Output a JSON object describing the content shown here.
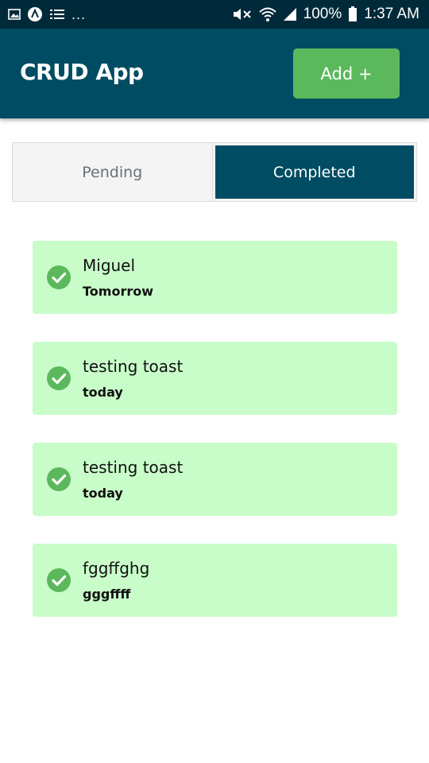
{
  "status_bar": {
    "dots": "...",
    "battery_percent": "100%",
    "time": "1:37 AM"
  },
  "header": {
    "title": "CRUD App",
    "add_label": "Add +"
  },
  "tabs": [
    {
      "label": "Pending",
      "active": false
    },
    {
      "label": "Completed",
      "active": true
    }
  ],
  "tasks": [
    {
      "title": "Miguel",
      "subtitle": "Tomorrow"
    },
    {
      "title": "testing toast",
      "subtitle": "today"
    },
    {
      "title": "testing toast",
      "subtitle": "today"
    },
    {
      "title": "fggffghg",
      "subtitle": "gggffff"
    }
  ],
  "icons": {
    "check": "check-circle-icon"
  },
  "colors": {
    "status_bar": "#002a3a",
    "app_bar": "#004c63",
    "add_button": "#5cb85c",
    "tab_active": "#004c63",
    "card_bg": "#c8fcc8",
    "check_green": "#5cb85c"
  }
}
